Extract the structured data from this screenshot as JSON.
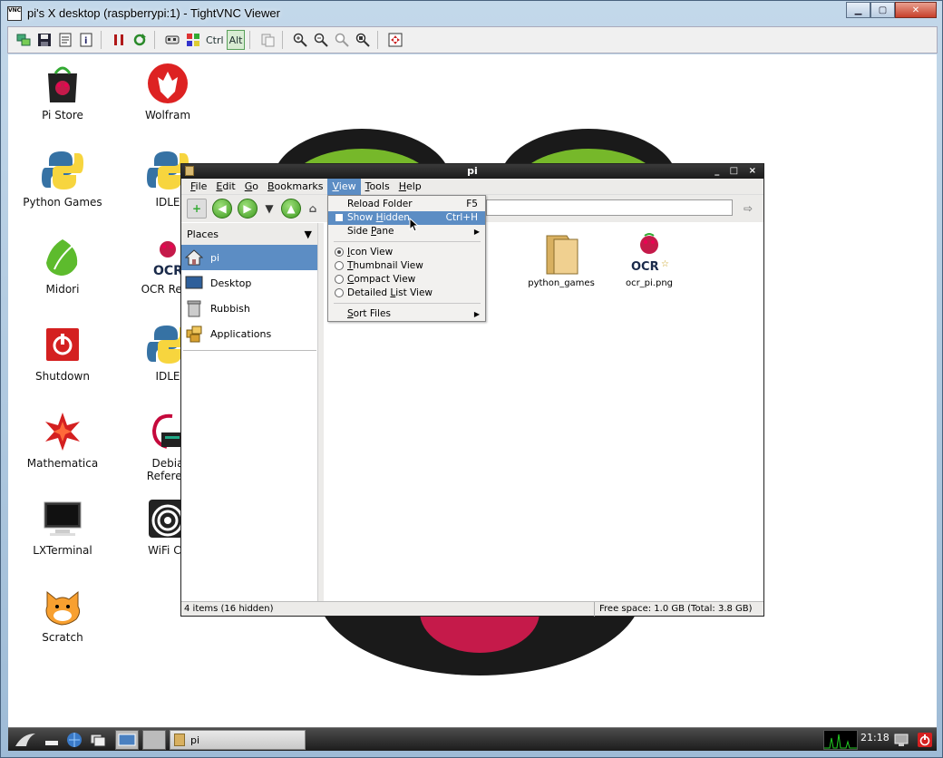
{
  "window": {
    "title": "pi's X desktop (raspberrypi:1) - TightVNC Viewer",
    "logo_text": "VNC",
    "minimize": "▁",
    "maximize": "▢",
    "close": "✕"
  },
  "vnc_toolbar": {
    "ctrl_label": "Ctrl",
    "alt_label": "Alt",
    "icons": [
      "new-connection-icon",
      "save-icon",
      "options-icon",
      "info-icon",
      "pause-icon",
      "refresh-icon",
      "ctrl-alt-del-icon",
      "start-menu-icon",
      "clipboard-icon",
      "zoom-in-icon",
      "zoom-out-icon",
      "zoom-100-icon",
      "zoom-auto-icon",
      "fullscreen-icon"
    ]
  },
  "desktop": {
    "icons": [
      {
        "label": "Pi Store"
      },
      {
        "label": "Wolfram"
      },
      {
        "label": "Python Games"
      },
      {
        "label": "IDLE"
      },
      {
        "label": "Midori"
      },
      {
        "label": "OCR Reso"
      },
      {
        "label": "Shutdown"
      },
      {
        "label": "IDLE"
      },
      {
        "label": "Mathematica"
      },
      {
        "label": "Debia"
      },
      {
        "label": "Referen"
      },
      {
        "label": "LXTerminal"
      },
      {
        "label": "WiFi Co"
      },
      {
        "label": "Scratch"
      }
    ]
  },
  "file_manager": {
    "title": "pi",
    "title_controls": "_ □ ×",
    "menus": [
      {
        "label": "File",
        "mnemonic": "F",
        "rest": "ile"
      },
      {
        "label": "Edit",
        "mnemonic": "E",
        "rest": "dit"
      },
      {
        "label": "Go",
        "mnemonic": "G",
        "rest": "o"
      },
      {
        "label": "Bookmarks",
        "mnemonic": "B",
        "rest": "ookmarks"
      },
      {
        "label": "View",
        "mnemonic": "V",
        "rest": "iew"
      },
      {
        "label": "Tools",
        "mnemonic": "T",
        "rest": "ools"
      },
      {
        "label": "Help",
        "mnemonic": "H",
        "rest": "elp"
      }
    ],
    "sidebar": {
      "header": "Places",
      "items": [
        {
          "label": "pi",
          "icon": "home-folder-icon"
        },
        {
          "label": "Desktop",
          "icon": "desktop-icon"
        },
        {
          "label": "Rubbish",
          "icon": "trash-icon"
        },
        {
          "label": "Applications",
          "icon": "applications-icon"
        }
      ]
    },
    "files": [
      {
        "name": "python_games",
        "icon": "folder-icon"
      },
      {
        "name": "ocr_pi.png",
        "icon": "image-file-icon"
      }
    ],
    "status_left": "4 items (16 hidden)",
    "status_right": "Free space: 1.0 GB (Total: 3.8 GB)"
  },
  "view_menu": {
    "reload": {
      "label": "Reload Folder",
      "accel": "F5"
    },
    "show_hidden": {
      "pre": "Show ",
      "mn": "H",
      "post": "idden",
      "accel": "Ctrl+H",
      "checked": false
    },
    "side_pane": {
      "pre": "Side ",
      "mn": "P",
      "post": "ane"
    },
    "icon_view": {
      "mn": "I",
      "post": "con View",
      "selected": true
    },
    "thumbnail_view": {
      "mn": "T",
      "post": "humbnail View",
      "selected": false
    },
    "compact_view": {
      "mn": "C",
      "post": "ompact View",
      "selected": false
    },
    "detailed_view": {
      "pre": "Detailed ",
      "mn": "L",
      "post": "ist View",
      "selected": false
    },
    "sort_files": {
      "mn": "S",
      "post": "ort Files"
    }
  },
  "taskbar": {
    "task_label": "pi",
    "clock": "21:18"
  },
  "colors": {
    "selection": "#5c8dc4",
    "taskbar": "#2b2b2b",
    "raspberry": "#c51a4a"
  }
}
